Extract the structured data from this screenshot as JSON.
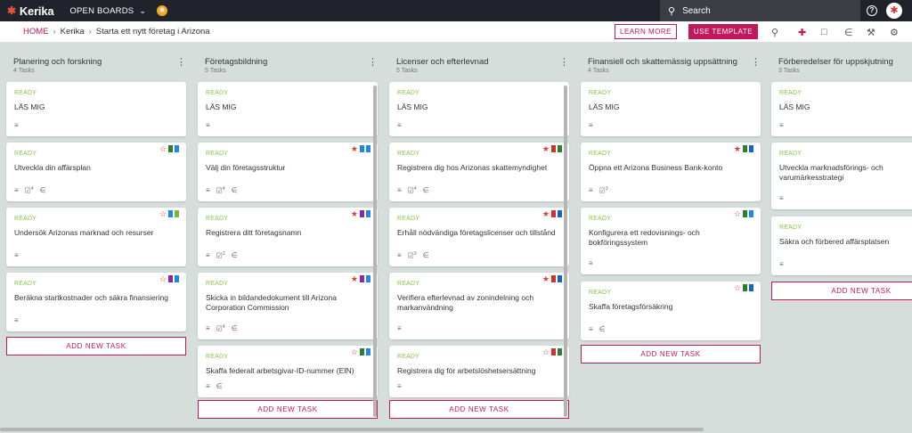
{
  "topbar": {
    "logo": "Kerika",
    "boards_label": "OPEN BOARDS",
    "search_placeholder": "Search"
  },
  "breadcrumb": {
    "home": "HOME",
    "items": [
      "Kerika",
      "Starta ett nytt företag i Arizona"
    ]
  },
  "actions": {
    "learn_more": "LEARN MORE",
    "use_template": "USE TEMPLATE"
  },
  "add_task_label": "ADD NEW TASK",
  "columns": [
    {
      "title": "Planering och forskning",
      "count": "4 Tasks",
      "cards": [
        {
          "status": "READY",
          "title": "LÄS MIG",
          "flags": [],
          "checklist": null,
          "attach": false
        },
        {
          "status": "READY",
          "title": "Utveckla din affärsplan",
          "flags": [
            "star-outline",
            "#2e7d32",
            "#1e88e5"
          ],
          "checklist": "4",
          "attach": true
        },
        {
          "status": "READY",
          "title": "Undersök Arizonas marknad och resurser",
          "flags": [
            "star-outline",
            "#1e88e5",
            "#7cb342"
          ],
          "checklist": null,
          "attach": false
        },
        {
          "status": "READY",
          "title": "Beräkna startkostnader och säkra finansiering",
          "flags": [
            "star-outline",
            "#8e24aa",
            "#1e88e5"
          ],
          "checklist": null,
          "attach": false
        }
      ]
    },
    {
      "title": "Företagsbildning",
      "count": "5 Tasks",
      "cards": [
        {
          "status": "READY",
          "title": "LÄS MIG",
          "flags": [],
          "checklist": null,
          "attach": false
        },
        {
          "status": "READY",
          "title": "Välj din företagsstruktur",
          "flags": [
            "star",
            "#1e88e5",
            "#1e88e5"
          ],
          "checklist": "4",
          "attach": true
        },
        {
          "status": "READY",
          "title": "Registrera ditt företagsnamn",
          "flags": [
            "star",
            "#8e24aa",
            "#1e88e5"
          ],
          "checklist": "2",
          "attach": true
        },
        {
          "status": "READY",
          "title": "Skicka in bildandedokument till Arizona Corporation Commission",
          "flags": [
            "star",
            "#8e24aa",
            "#1e88e5"
          ],
          "checklist": "4",
          "attach": true
        },
        {
          "status": "READY",
          "title": "Skaffa federalt arbetsgivar-ID-nummer (EIN)",
          "flags": [
            "star-outline",
            "#2e7d32",
            "#1e88e5"
          ],
          "checklist": null,
          "attach": true
        }
      ]
    },
    {
      "title": "Licenser och efterlevnad",
      "count": "5 Tasks",
      "cards": [
        {
          "status": "READY",
          "title": "LÄS MIG",
          "flags": [],
          "checklist": null,
          "attach": false
        },
        {
          "status": "READY",
          "title": "Registrera dig hos Arizonas skattemyndighet",
          "flags": [
            "star",
            "#d32f2f",
            "#2e7d32"
          ],
          "checklist": "4",
          "attach": true
        },
        {
          "status": "READY",
          "title": "Erhåll nödvändiga företagslicenser och tillstånd",
          "flags": [
            "star",
            "#d32f2f",
            "#1565c0"
          ],
          "checklist": "3",
          "attach": true
        },
        {
          "status": "READY",
          "title": "Verifiera efterlevnad av zonindelning och markanvändning",
          "flags": [
            "star",
            "#d32f2f",
            "#1565c0"
          ],
          "checklist": null,
          "attach": false
        },
        {
          "status": "READY",
          "title": "Registrera dig för arbetslöshetsersättning",
          "flags": [
            "star-outline",
            "#d32f2f",
            "#2e7d32"
          ],
          "checklist": null,
          "attach": false
        }
      ]
    },
    {
      "title": "Finansiell och skattemässig uppsättning",
      "count": "4 Tasks",
      "cards": [
        {
          "status": "READY",
          "title": "LÄS MIG",
          "flags": [],
          "checklist": null,
          "attach": false
        },
        {
          "status": "READY",
          "title": "Öppna ett Arizona Business Bank-konto",
          "flags": [
            "star",
            "#2e7d32",
            "#1565c0"
          ],
          "checklist": "3",
          "attach": false
        },
        {
          "status": "READY",
          "title": "Konfigurera ett redovisnings- och bokföringssystem",
          "flags": [
            "star-outline",
            "#2e7d32",
            "#1e88e5"
          ],
          "checklist": null,
          "attach": false
        },
        {
          "status": "READY",
          "title": "Skaffa företagsförsäkring",
          "flags": [
            "star-outline",
            "#2e7d32",
            "#1565c0"
          ],
          "checklist": null,
          "attach": true
        }
      ]
    },
    {
      "title": "Förberedelser för uppskjutning",
      "count": "3 Tasks",
      "cards": [
        {
          "status": "READY",
          "title": "LÄS MIG",
          "flags": [],
          "checklist": null,
          "attach": false
        },
        {
          "status": "READY",
          "title": "Utveckla marknadsförings- och varumärkesstrategi",
          "flags": [],
          "checklist": null,
          "attach": false
        },
        {
          "status": "READY",
          "title": "Säkra och förbered affärsplatsen",
          "flags": [],
          "checklist": null,
          "attach": false
        }
      ]
    }
  ]
}
